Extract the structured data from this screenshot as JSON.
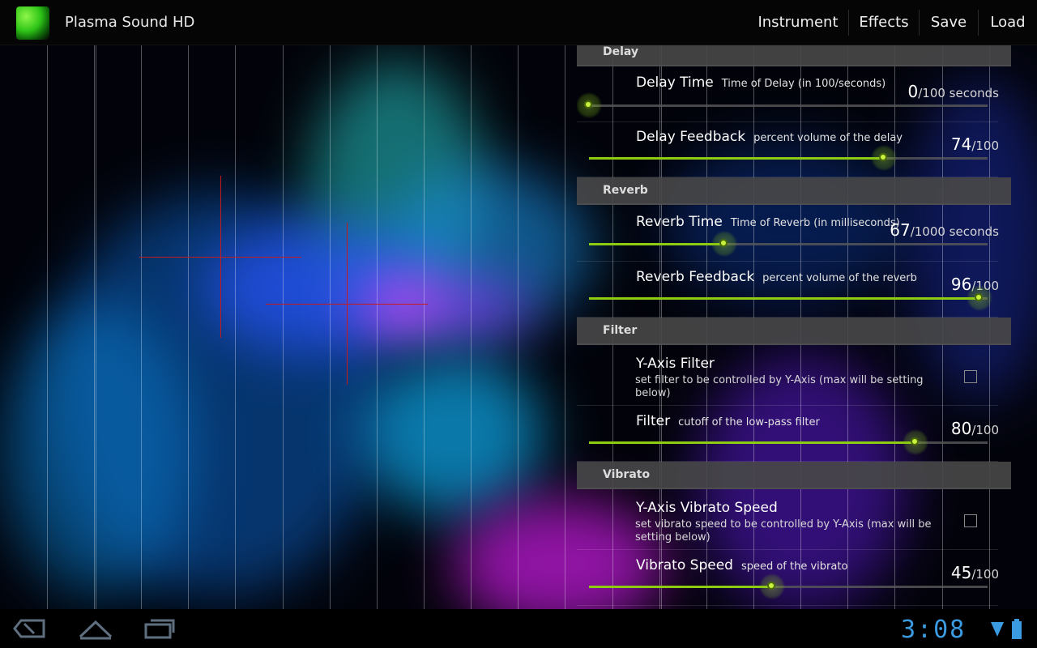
{
  "app": {
    "title": "Plasma Sound HD",
    "icon": "plasma-app-icon"
  },
  "menu": [
    {
      "label": "Instrument"
    },
    {
      "label": "Effects"
    },
    {
      "label": "Save"
    },
    {
      "label": "Load"
    }
  ],
  "sections": {
    "delay": {
      "header": "Delay",
      "delay_time": {
        "title": "Delay Time",
        "summary": "Time of Delay (in 100/seconds)",
        "value": "0",
        "unit": "/100 seconds",
        "fraction": 0.0
      },
      "delay_feedback": {
        "title": "Delay Feedback",
        "summary": "percent volume of the delay",
        "value": "74",
        "unit": "/100",
        "fraction": 0.74
      }
    },
    "reverb": {
      "header": "Reverb",
      "reverb_time": {
        "title": "Reverb Time",
        "summary": "Time of Reverb (in milliseconds)",
        "value": "67",
        "unit": "/1000 seconds",
        "fraction": 0.34
      },
      "reverb_feedback": {
        "title": "Reverb Feedback",
        "summary": "percent volume of the reverb",
        "value": "96",
        "unit": "/100",
        "fraction": 0.98
      }
    },
    "filter": {
      "header": "Filter",
      "y_axis_filter": {
        "title": "Y-Axis Filter",
        "summary": "set filter to be controlled by Y-Axis (max will be setting below)",
        "checked": false
      },
      "filter": {
        "title": "Filter",
        "summary": "cutoff of the low-pass filter",
        "value": "80",
        "unit": "/100",
        "fraction": 0.82
      }
    },
    "vibrato": {
      "header": "Vibrato",
      "y_axis_vibrato": {
        "title": "Y-Axis Vibrato Speed",
        "summary": "set vibrato speed to be controlled by Y-Axis (max will be setting below)",
        "checked": false
      },
      "vibrato_speed": {
        "title": "Vibrato Speed",
        "summary": "speed of the vibrato",
        "value": "45",
        "unit": "/100",
        "fraction": 0.46
      }
    }
  },
  "status": {
    "clock": "3:08"
  },
  "colors": {
    "accent": "#8ecc12",
    "clock": "#3a9be0",
    "crosshair": "#c71a1a"
  }
}
